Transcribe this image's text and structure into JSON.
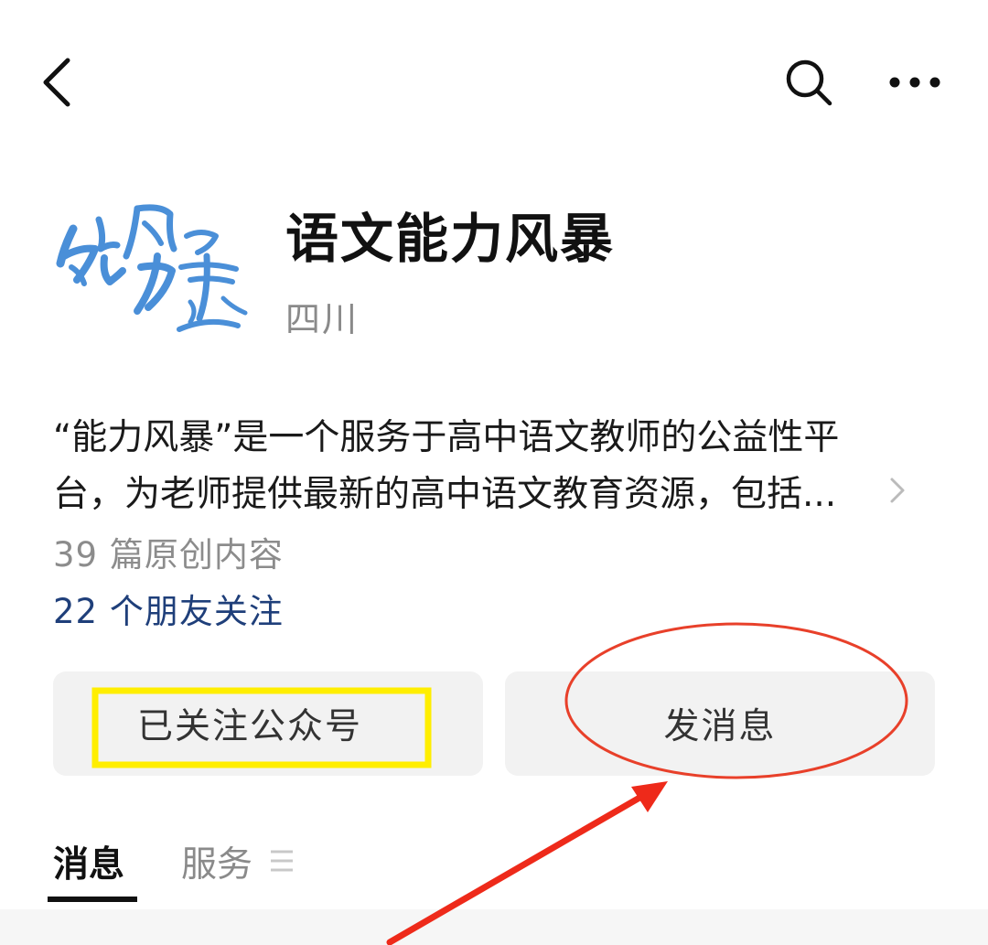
{
  "header": {
    "back_icon": "chevron-left-icon",
    "search_icon": "search-icon",
    "more_icon": "ellipsis-icon"
  },
  "profile": {
    "name": "语文能力风暴",
    "region": "四川",
    "avatar_logo": "能力风暴"
  },
  "description": {
    "line1": "“能力风暴”是一个服务于高中语文教师的公益性平",
    "line2": "台，为老师提供最新的高中语文教育资源，包括..."
  },
  "stats": {
    "original_content": "39 篇原创内容",
    "friends_following": "22 个朋友关注"
  },
  "actions": {
    "follow_label": "已关注公众号",
    "message_label": "发消息"
  },
  "tabs": [
    {
      "label": "消息",
      "active": true
    },
    {
      "label": "服务",
      "active": false
    }
  ],
  "colors": {
    "accent_link": "#1f3f7a",
    "logo_blue": "#4a8fd8",
    "annotation_yellow": "#ffee00",
    "annotation_red": "#e8402a"
  }
}
